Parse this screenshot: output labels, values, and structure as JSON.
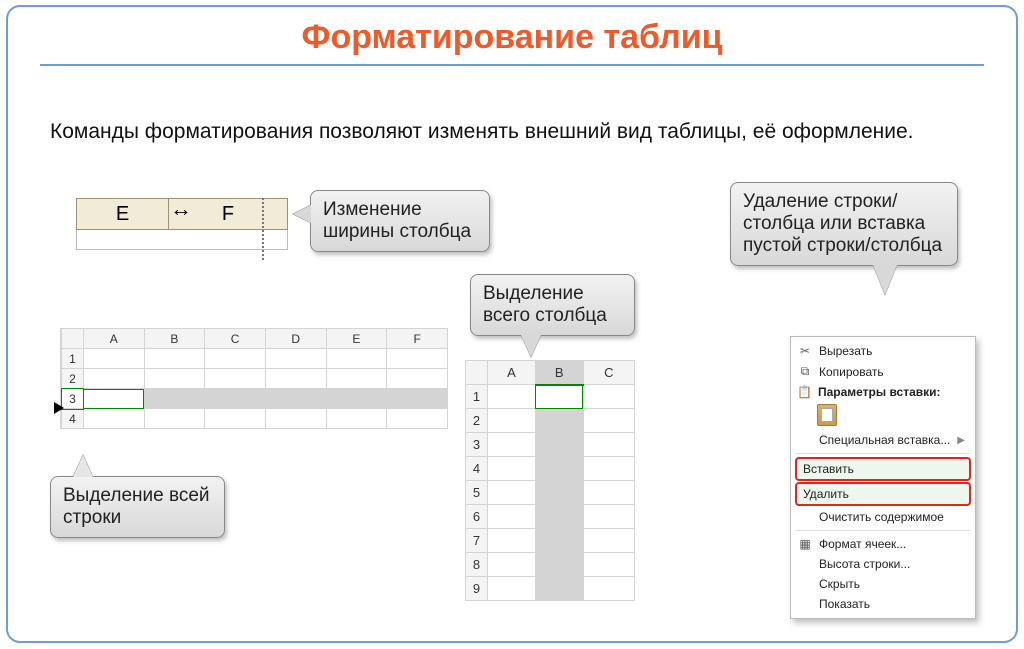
{
  "title": "Форматирование таблиц",
  "intro": "Команды форматирования позволяют изменять внешний вид таблицы, её оформление.",
  "callouts": {
    "width": "Изменение ширины столбца",
    "select_column": "Выделение всего столбца",
    "select_row": "Выделение всей строки",
    "delete_insert": "Удаление строки/столбца или вставка пустой строки/столбца"
  },
  "ef": {
    "left_col": "E",
    "right_col": "F",
    "cursor": "↔"
  },
  "grid1": {
    "columns": [
      "A",
      "B",
      "C",
      "D",
      "E",
      "F"
    ],
    "rows": [
      "1",
      "2",
      "3",
      "4"
    ],
    "selected_row": "3"
  },
  "grid2": {
    "columns": [
      "A",
      "B",
      "C"
    ],
    "rows": [
      "1",
      "2",
      "3",
      "4",
      "5",
      "6",
      "7",
      "8",
      "9"
    ],
    "selected_col": "B"
  },
  "context_menu": {
    "cut": "Вырезать",
    "copy": "Копировать",
    "paste_params": "Параметры вставки:",
    "paste_special": "Специальная вставка...",
    "insert": "Вставить",
    "delete": "Удалить",
    "clear": "Очистить содержимое",
    "format_cells": "Формат ячеек...",
    "row_height": "Высота строки...",
    "hide": "Скрыть",
    "show": "Показать",
    "icons": {
      "cut": "✂",
      "copy": "⧉",
      "clipboard": "📋",
      "format": "▦"
    }
  }
}
